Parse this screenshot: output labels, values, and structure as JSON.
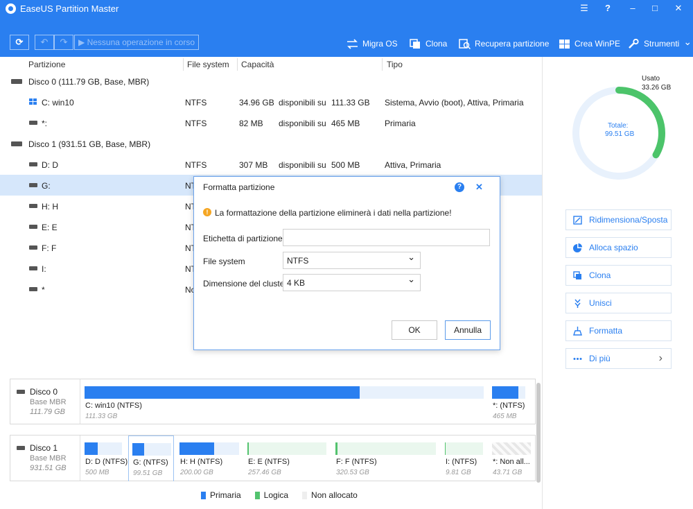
{
  "app": {
    "title": "EaseUS Partition Master"
  },
  "window_controls": {
    "menu": "☰",
    "help": "?",
    "minimize": "–",
    "maximize": "□",
    "close": "✕"
  },
  "toolbar": {
    "refresh": "⟳",
    "undo": "↶",
    "redo": "↷",
    "pending": "▶  Nessuna operazione in corso",
    "actions": {
      "migrate": "Migra OS",
      "clone": "Clona",
      "recover": "Recupera partizione",
      "winpe": "Crea WinPE",
      "tools": "Strumenti",
      "tools_chevron": "⌄"
    }
  },
  "table": {
    "headers": {
      "partition": "Partizione",
      "fs": "File system",
      "capacity": "Capacità",
      "type": "Tipo"
    },
    "disk0": "Disco 0 (111.79 GB, Base, MBR)",
    "disk1": "Disco 1 (931.51 GB, Base, MBR)",
    "rows": [
      {
        "name": "C: win10",
        "fs": "NTFS",
        "used": "34.96 GB",
        "avail": "disponibili su",
        "total": "111.33 GB",
        "type": "Sistema, Avvio (boot), Attiva, Primaria"
      },
      {
        "name": "*:",
        "fs": "NTFS",
        "used": "82 MB",
        "avail": "disponibili su",
        "total": "465 MB",
        "type": "Primaria"
      },
      {
        "name": "D: D",
        "fs": "NTFS",
        "used": "307 MB",
        "avail": "disponibili su",
        "total": "500 MB",
        "type": "Attiva, Primaria"
      },
      {
        "name": "G:",
        "fs": "NT"
      },
      {
        "name": "H: H",
        "fs": "NT"
      },
      {
        "name": "E: E",
        "fs": "NT"
      },
      {
        "name": "F: F",
        "fs": "NT"
      },
      {
        "name": "I:",
        "fs": "NT"
      },
      {
        "name": "*",
        "fs": "No"
      }
    ]
  },
  "sidebar": {
    "used_label": "Usato",
    "used_value": "33.26 GB",
    "total_label": "Totale:",
    "total_value": "99.51 GB",
    "used_fraction": 0.334,
    "buttons": {
      "resize": "Ridimensiona/Sposta",
      "allocate": "Alloca spazio",
      "clone": "Clona",
      "merge": "Unisci",
      "format": "Formatta",
      "more": "Di più",
      "more_chevron": "›"
    }
  },
  "diskmap": {
    "disk0": {
      "label": "Disco 0",
      "kind": "Base MBR",
      "size": "111.79 GB",
      "parts": [
        {
          "name": "C: win10 (NTFS)",
          "size": "111.33 GB",
          "fill": 0.69
        },
        {
          "name": "*: (NTFS)",
          "size": "465 MB",
          "fill": 0.8
        }
      ]
    },
    "disk1": {
      "label": "Disco 1",
      "kind": "Base MBR",
      "size": "931.51 GB",
      "parts": [
        {
          "name": "D: D (NTFS)",
          "size": "500 MB",
          "fill": 0.35
        },
        {
          "name": "G: (NTFS)",
          "size": "99.51 GB",
          "fill": 0.3
        },
        {
          "name": "H: H (NTFS)",
          "size": "200.00 GB",
          "fill": 0.58
        },
        {
          "name": "E: E (NTFS)",
          "size": "257.46 GB",
          "fill": 0.02
        },
        {
          "name": "F: F (NTFS)",
          "size": "320.53 GB",
          "fill": 0.02
        },
        {
          "name": "I:  (NTFS)",
          "size": "9.81 GB",
          "fill": 0.02
        },
        {
          "name": "*: Non all...",
          "size": "43.71 GB",
          "fill": 0
        }
      ]
    }
  },
  "legend": {
    "primary": "Primaria",
    "logical": "Logica",
    "unallocated": "Non allocato"
  },
  "colors": {
    "accent": "#2a7ff0",
    "logical": "#53c36e",
    "used_ring": "#4cc46a",
    "ring_bg": "#e8f1fc",
    "warning": "#f5a623"
  },
  "dialog": {
    "title": "Formatta partizione",
    "help": "?",
    "close": "✕",
    "warning_icon": "!",
    "warning": "La formattazione della partizione eliminerà i dati nella partizione!",
    "label_caption": "Etichetta di partizione",
    "label_value": "",
    "fs_caption": "File system",
    "fs_value": "NTFS",
    "cluster_caption": "Dimensione del cluster",
    "cluster_value": "4 KB",
    "chevron": "⌄",
    "ok": "OK",
    "cancel": "Annulla"
  }
}
